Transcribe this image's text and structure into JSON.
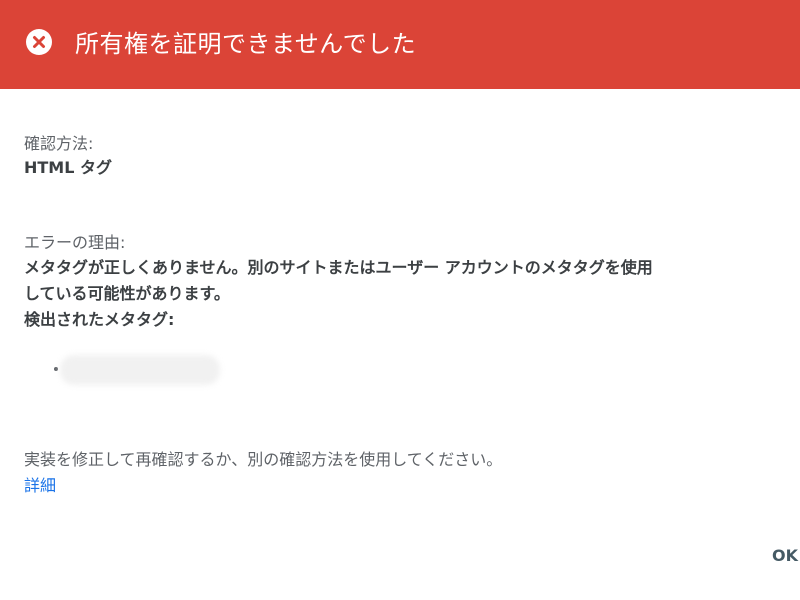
{
  "header": {
    "icon": "close-circle-icon",
    "title": "所有権を証明できませんでした",
    "background_color": "#db4437"
  },
  "method": {
    "label": "確認方法:",
    "value": "HTML タグ"
  },
  "error": {
    "label": "エラーの理由:",
    "line1": "メタタグが正しくありません。別のサイトまたはユーザー アカウントのメタタグを使用",
    "line2": "している可能性があります。",
    "detected_label": "検出されたメタタグ:"
  },
  "instructions": "実装を修正して再確認するか、別の確認方法を使用してください。",
  "learn_more": "詳細",
  "ok_button": "OK",
  "colors": {
    "link": "#1a73e8",
    "text": "#3c4043"
  }
}
